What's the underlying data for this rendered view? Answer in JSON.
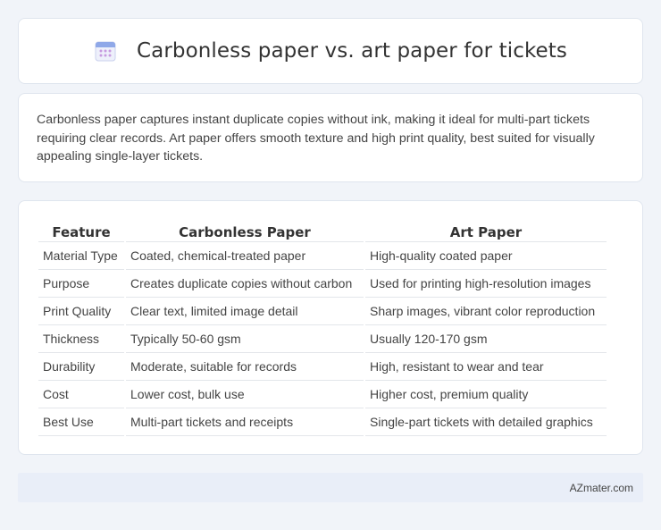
{
  "header": {
    "title": "Carbonless paper vs. art paper for tickets",
    "icon": "calendar-icon"
  },
  "intro": {
    "text": "Carbonless paper captures instant duplicate copies without ink, making it ideal for multi-part tickets requiring clear records. Art paper offers smooth texture and high print quality, best suited for visually appealing single-layer tickets."
  },
  "table": {
    "headers": [
      "Feature",
      "Carbonless Paper",
      "Art Paper"
    ],
    "rows": [
      [
        "Material Type",
        "Coated, chemical-treated paper",
        "High-quality coated paper"
      ],
      [
        "Purpose",
        "Creates duplicate copies without carbon",
        "Used for printing high-resolution images"
      ],
      [
        "Print Quality",
        "Clear text, limited image detail",
        "Sharp images, vibrant color reproduction"
      ],
      [
        "Thickness",
        "Typically 50-60 gsm",
        "Usually 120-170 gsm"
      ],
      [
        "Durability",
        "Moderate, suitable for records",
        "High, resistant to wear and tear"
      ],
      [
        "Cost",
        "Lower cost, bulk use",
        "Higher cost, premium quality"
      ],
      [
        "Best Use",
        "Multi-part tickets and receipts",
        "Single-part tickets with detailed graphics"
      ]
    ]
  },
  "footer": {
    "brand": "AZmater.com"
  },
  "colors": {
    "background": "#f1f4f9",
    "card": "#ffffff",
    "footer": "#e9eef8",
    "icon_top": "#8fa8e8",
    "icon_dots": "#c79be0"
  }
}
